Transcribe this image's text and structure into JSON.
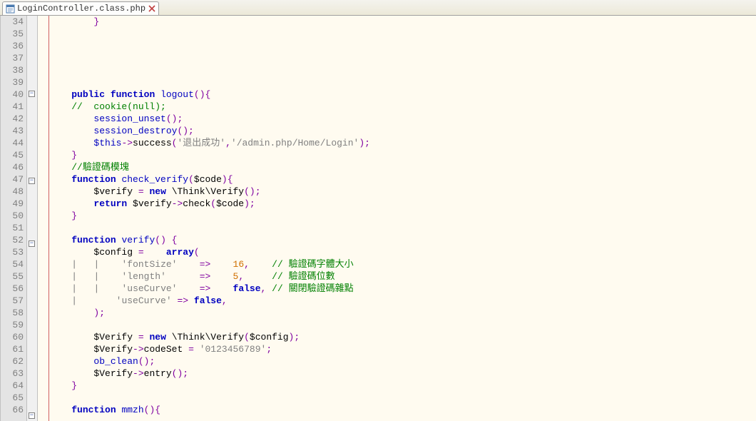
{
  "tab": {
    "filename": "LoginController.class.php"
  },
  "gutter": {
    "start": 34,
    "end": 66
  },
  "fold_markers": {
    "40": "-",
    "47": "-",
    "52": "-",
    "66": "-"
  },
  "code_lines": [
    {
      "n": 34,
      "html": "        <span class='op'>}</span>"
    },
    {
      "n": 35,
      "html": ""
    },
    {
      "n": 36,
      "html": ""
    },
    {
      "n": 37,
      "html": ""
    },
    {
      "n": 38,
      "html": ""
    },
    {
      "n": 39,
      "html": ""
    },
    {
      "n": 40,
      "html": "    <span class='kw'>public</span> <span class='kw'>function</span> <span class='func'>logout</span><span class='op'>(){</span>"
    },
    {
      "n": 41,
      "html": "    <span class='com'>//  cookie(null);</span>"
    },
    {
      "n": 42,
      "html": "        <span class='func'>session_unset</span><span class='op'>();</span>"
    },
    {
      "n": 43,
      "html": "        <span class='func'>session_destroy</span><span class='op'>();</span>"
    },
    {
      "n": 44,
      "html": "        <span class='kw2'>$this</span><span class='op'>-&gt;</span><span class='var'>success</span><span class='op'>(</span><span class='str'>'退出成功'</span><span class='op'>,</span><span class='str'>'/admin.php/Home/Login'</span><span class='op'>);</span>"
    },
    {
      "n": 45,
      "html": "    <span class='op'>}</span>"
    },
    {
      "n": 46,
      "html": "    <span class='com'>//驗證碼模塊</span>"
    },
    {
      "n": 47,
      "html": "    <span class='kw'>function</span> <span class='func'>check_verify</span><span class='op'>(</span><span class='var'>$code</span><span class='op'>){</span>"
    },
    {
      "n": 48,
      "html": "        <span class='var'>$verify</span> <span class='op'>=</span> <span class='kw'>new</span> <span class='var'>\\Think\\Verify</span><span class='op'>();</span>"
    },
    {
      "n": 49,
      "html": "        <span class='kw'>return</span> <span class='var'>$verify</span><span class='op'>-&gt;</span><span class='var'>check</span><span class='op'>(</span><span class='var'>$code</span><span class='op'>);</span>"
    },
    {
      "n": 50,
      "html": "    <span class='op'>}</span>"
    },
    {
      "n": 51,
      "html": ""
    },
    {
      "n": 52,
      "html": "    <span class='kw'>function</span> <span class='func'>verify</span><span class='op'>() {</span>"
    },
    {
      "n": 53,
      "html": "        <span class='var'>$config</span> <span class='op'>=</span>    <span class='kw'>array</span><span class='op'>(</span>"
    },
    {
      "n": 54,
      "html": "    <span class='str'>|</span>   <span class='str'>|</span>    <span class='str'>'fontSize'</span>    <span class='op'>=&gt;</span>    <span class='num'>16</span><span class='op'>,</span>    <span class='com'>// 驗證碼字體大小</span>"
    },
    {
      "n": 55,
      "html": "    <span class='str'>|</span>   <span class='str'>|</span>    <span class='str'>'length'</span>      <span class='op'>=&gt;</span>    <span class='num'>5</span><span class='op'>,</span>     <span class='com'>// 驗證碼位數</span>"
    },
    {
      "n": 56,
      "html": "    <span class='str'>|</span>   <span class='str'>|</span>    <span class='str'>'useCurve'</span>    <span class='op'>=&gt;</span>    <span class='kw'>false</span><span class='op'>,</span> <span class='com'>// 關閉驗證碼雜點</span>"
    },
    {
      "n": 57,
      "html": "    <span class='str'>|</span>       <span class='str'>'useCurve'</span> <span class='op'>=&gt;</span> <span class='kw'>false</span><span class='op'>,</span>"
    },
    {
      "n": 58,
      "html": "        <span class='op'>);</span>"
    },
    {
      "n": 59,
      "html": ""
    },
    {
      "n": 60,
      "html": "        <span class='var'>$Verify</span> <span class='op'>=</span> <span class='kw'>new</span> <span class='var'>\\Think\\Verify</span><span class='op'>(</span><span class='var'>$config</span><span class='op'>);</span>"
    },
    {
      "n": 61,
      "html": "        <span class='var'>$Verify</span><span class='op'>-&gt;</span><span class='var'>codeSet</span> <span class='op'>=</span> <span class='str'>'0123456789'</span><span class='op'>;</span>"
    },
    {
      "n": 62,
      "html": "        <span class='func'>ob_clean</span><span class='op'>();</span>"
    },
    {
      "n": 63,
      "html": "        <span class='var'>$Verify</span><span class='op'>-&gt;</span><span class='var'>entry</span><span class='op'>();</span>"
    },
    {
      "n": 64,
      "html": "    <span class='op'>}</span>"
    },
    {
      "n": 65,
      "html": ""
    },
    {
      "n": 66,
      "html": "    <span class='kw'>function</span> <span class='func'>mmzh</span><span class='op'>(){</span>"
    }
  ]
}
